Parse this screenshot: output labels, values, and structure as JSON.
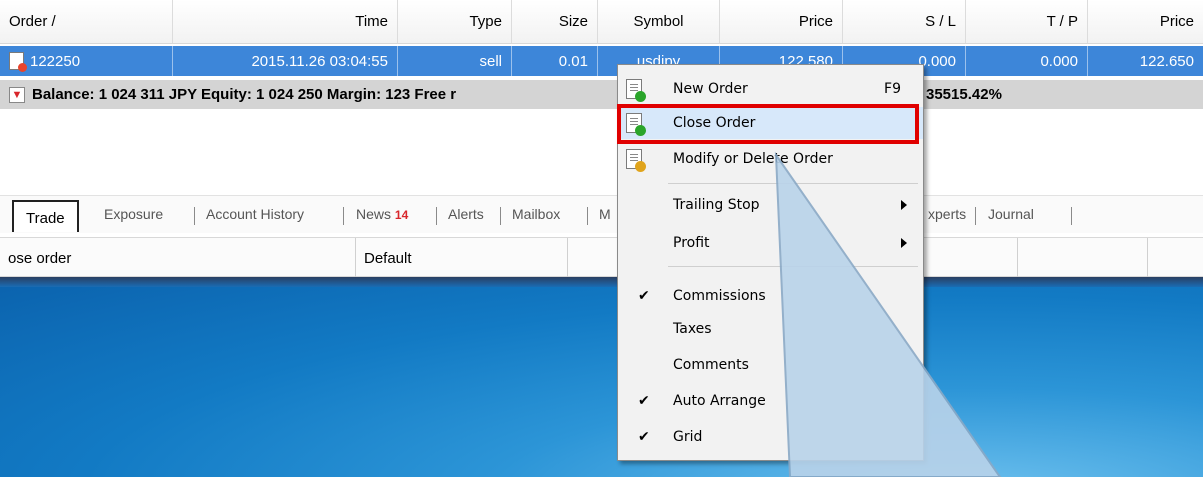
{
  "table": {
    "headers": [
      {
        "label": "Order  /",
        "align": "left"
      },
      {
        "label": "Time",
        "align": "right"
      },
      {
        "label": "Type",
        "align": "right"
      },
      {
        "label": "Size",
        "align": "right"
      },
      {
        "label": "Symbol",
        "align": "center"
      },
      {
        "label": "Price",
        "align": "right"
      },
      {
        "label": "S / L",
        "align": "right"
      },
      {
        "label": "T / P",
        "align": "right"
      },
      {
        "label": "Price",
        "align": "right"
      }
    ],
    "selected_row": {
      "order": "122250",
      "time": "2015.11.26 03:04:55",
      "type": "sell",
      "size": "0.01",
      "symbol": "usdjpy",
      "price": "122.580",
      "sl": "0.000",
      "tp": "0.000",
      "price2": "122.650"
    },
    "balance_line_left": "Balance: 1 024 311 JPY  Equity: 1 024 250  Margin: 123  Free r",
    "balance_line_right": "35515.42%"
  },
  "tabs": [
    {
      "label": "Trade",
      "active": true
    },
    {
      "label": "Exposure"
    },
    {
      "label": "Account History"
    },
    {
      "label": "News",
      "badge": "14"
    },
    {
      "label": "Alerts"
    },
    {
      "label": "Mailbox"
    },
    {
      "label": "M"
    },
    {
      "label": "xperts"
    },
    {
      "label": "Journal"
    }
  ],
  "status": {
    "message": "ose order",
    "profile": "Default"
  },
  "context_menu": {
    "items": [
      {
        "label": "New Order",
        "shortcut": "F9",
        "icon": "new-order-icon",
        "icon_color": "#2aa52a"
      },
      {
        "label": "Close Order",
        "icon": "close-order-icon",
        "icon_color": "#2aa52a",
        "highlighted": true
      },
      {
        "label": "Modify or Delete Order",
        "icon": "modify-order-icon",
        "icon_color": "#e0a41c"
      },
      {
        "label": "Trailing Stop",
        "submenu": true
      },
      {
        "label": "Profit",
        "submenu": true
      },
      {
        "label": "Commissions",
        "checked": true
      },
      {
        "label": "Taxes"
      },
      {
        "label": "Comments"
      },
      {
        "label": "Auto Arrange",
        "checked": true
      },
      {
        "label": "Grid",
        "checked": true
      }
    ]
  },
  "colors": {
    "selection": "#3d86d9",
    "highlight_box": "#e00000",
    "callout_fill": "#b9d3ea"
  }
}
